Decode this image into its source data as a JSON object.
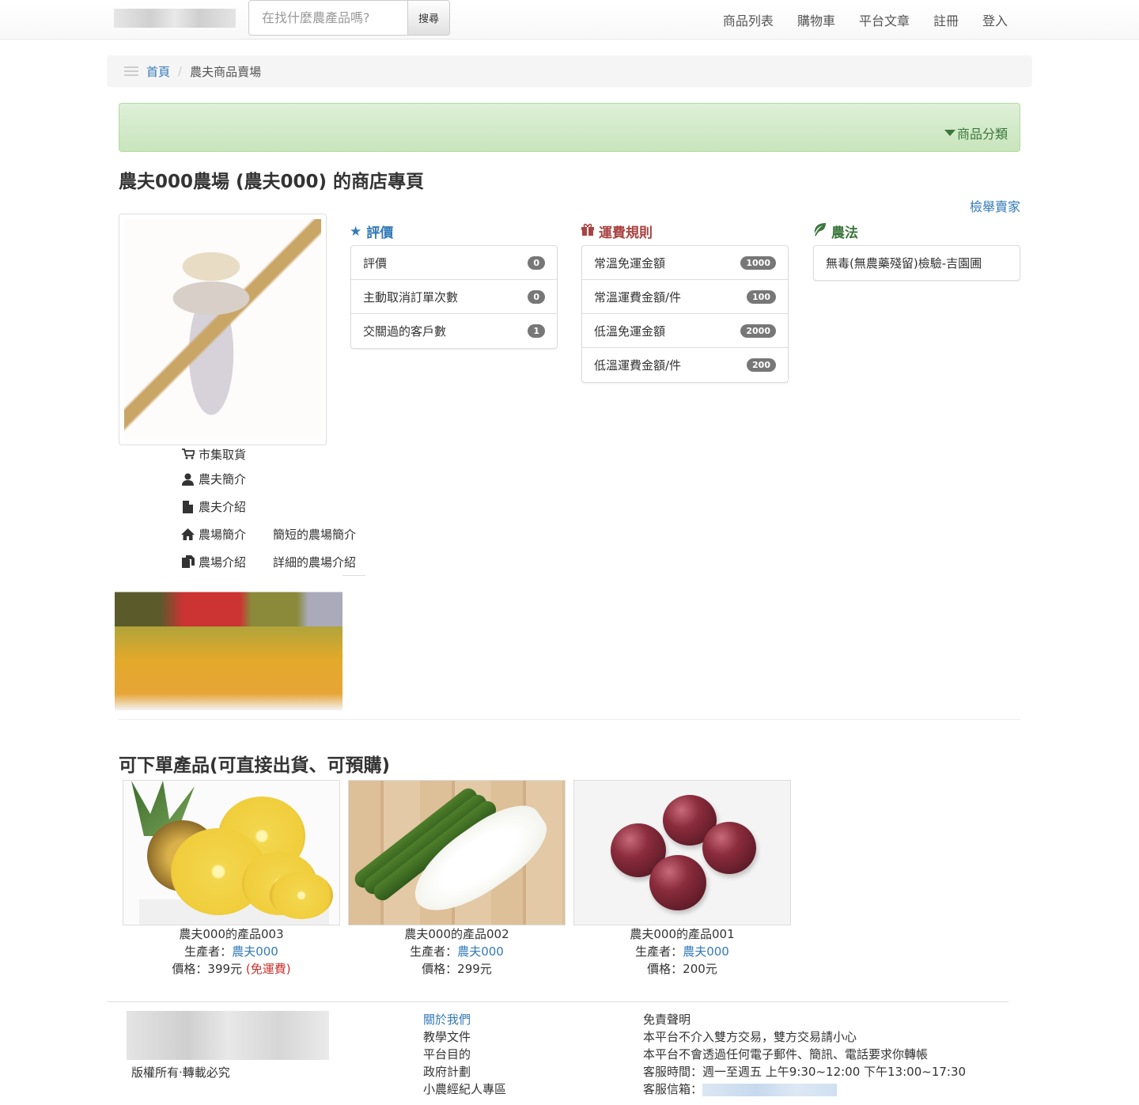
{
  "nav": {
    "search_placeholder": "在找什麼農產品嗎?",
    "search_button": "搜尋",
    "links": [
      "商品列表",
      "購物車",
      "平台文章",
      "註冊",
      "登入"
    ]
  },
  "breadcrumb": {
    "home": "首頁",
    "separator": "/",
    "current": "農夫商品賣場"
  },
  "category": {
    "toggle": "商品分類"
  },
  "shop": {
    "title": "農夫000農場 (農夫000) 的商店專頁",
    "report": "檢舉賣家"
  },
  "farm_links": [
    {
      "icon": "cart-icon",
      "label": "市集取貨",
      "desc": ""
    },
    {
      "icon": "user-icon",
      "label": "農夫簡介",
      "desc": ""
    },
    {
      "icon": "file-icon",
      "label": "農夫介紹",
      "desc": ""
    },
    {
      "icon": "home-icon",
      "label": "農場簡介",
      "desc": "簡短的農場簡介"
    },
    {
      "icon": "files-icon",
      "label": "農場介紹",
      "desc": "詳細的農場介紹"
    }
  ],
  "ratings": {
    "title": "評價",
    "icon": "star-icon",
    "color": "#337ab7",
    "items": [
      {
        "label": "評價",
        "value": "0"
      },
      {
        "label": "主動取消訂單次數",
        "value": "0"
      },
      {
        "label": "交關過的客戶數",
        "value": "1"
      }
    ]
  },
  "shipping": {
    "title": "運費規則",
    "icon": "gift-icon",
    "color": "#a94442",
    "items": [
      {
        "label": "常溫免運金額",
        "value": "1000"
      },
      {
        "label": "常溫運費金額/件",
        "value": "100"
      },
      {
        "label": "低溫免運金額",
        "value": "2000"
      },
      {
        "label": "低溫運費金額/件",
        "value": "200"
      }
    ]
  },
  "farming": {
    "title": "農法",
    "icon": "leaf-icon",
    "color": "#3c763d",
    "items": [
      {
        "label": "無毒(無農藥殘留)檢驗-吉園圃"
      }
    ]
  },
  "products_section": {
    "title": "可下單產品(可直接出貨、可預購)"
  },
  "products": [
    {
      "name": "農夫000的產品003",
      "producer_label": "生產者：",
      "producer": "農夫000",
      "price": "價格：399元",
      "free_shipping": "(免運費)"
    },
    {
      "name": "農夫000的產品002",
      "producer_label": "生產者：",
      "producer": "農夫000",
      "price": "價格：299元",
      "free_shipping": ""
    },
    {
      "name": "農夫000的產品001",
      "producer_label": "生產者：",
      "producer": "農夫000",
      "price": "價格：200元",
      "free_shipping": ""
    }
  ],
  "footer": {
    "copyright": "版權所有·轉載必究",
    "links": [
      "關於我們",
      "教學文件",
      "平台目的",
      "政府計劃",
      "小農經紀人專區"
    ],
    "disclaimer_title": "免責聲明",
    "disclaimer_lines": [
      "本平台不介入雙方交易，雙方交易請小心",
      "本平台不會透過任何電子郵件、簡訊、電話要求你轉帳",
      "客服時間：週一至週五 上午9:30~12:00 下午13:00~17:30"
    ],
    "email_label": "客服信箱："
  }
}
